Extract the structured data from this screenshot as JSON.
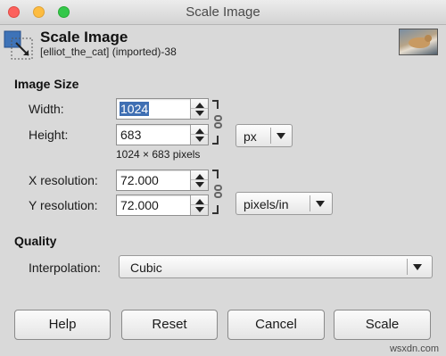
{
  "window": {
    "title": "Scale Image"
  },
  "header": {
    "title": "Scale Image",
    "subtitle": "[elliot_the_cat] (imported)-38",
    "icon": "scale-image-icon",
    "thumbnail": "image-thumbnail"
  },
  "image_size": {
    "section_label": "Image Size",
    "width_label": "Width:",
    "width_value": "1024",
    "height_label": "Height:",
    "height_value": "683",
    "pixels_info": "1024 × 683 pixels",
    "unit": "px",
    "x_res_label": "X resolution:",
    "x_res_value": "72.000",
    "y_res_label": "Y resolution:",
    "y_res_value": "72.000",
    "res_unit": "pixels/in"
  },
  "quality": {
    "section_label": "Quality",
    "interp_label": "Interpolation:",
    "interp_value": "Cubic"
  },
  "buttons": {
    "help": "Help",
    "reset": "Reset",
    "cancel": "Cancel",
    "scale": "Scale"
  },
  "watermark": "wsxdn.com"
}
